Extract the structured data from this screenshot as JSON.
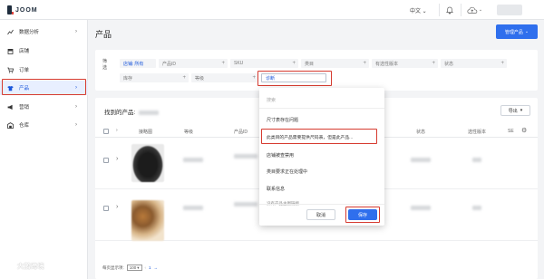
{
  "topbar": {
    "brand": "JOOM",
    "language": "中文"
  },
  "sidebar": {
    "items": [
      {
        "label": "数据分析"
      },
      {
        "label": "店铺"
      },
      {
        "label": "订单"
      },
      {
        "label": "产品"
      },
      {
        "label": "营销"
      },
      {
        "label": "仓库"
      }
    ]
  },
  "page": {
    "title": "产品",
    "manage_button": "管理产品"
  },
  "filters": {
    "label": "筛选",
    "store_label": "店铺:",
    "store_value": "所有",
    "product_id": "产品ID",
    "sku": "SKU",
    "category": "类目",
    "optional_version": "有选性版本",
    "status": "状态",
    "inventory": "库存",
    "level": "等级",
    "input_value": "诊断"
  },
  "results": {
    "title": "找到的产品:",
    "export_button": "导出",
    "columns": {
      "main_image": "接略图",
      "level": "等级",
      "product": "产品ID",
      "status": "状态",
      "version": "选性版本",
      "extra": "SE"
    }
  },
  "dropdown": {
    "search_placeholder": "搜索",
    "items": [
      "尺寸表存在问题",
      "此类目的产品需要提供尺码表，但是此产品...",
      "店铺被查禁用",
      "类目要求正在处理中",
      "联系信息",
      "没有产品主图链接"
    ],
    "cancel": "取消",
    "save": "保存"
  },
  "pagination": {
    "per_page_label": "每页显示项:",
    "per_page_value": "100",
    "page": "1"
  },
  "watermark": "大鹅跨境"
}
